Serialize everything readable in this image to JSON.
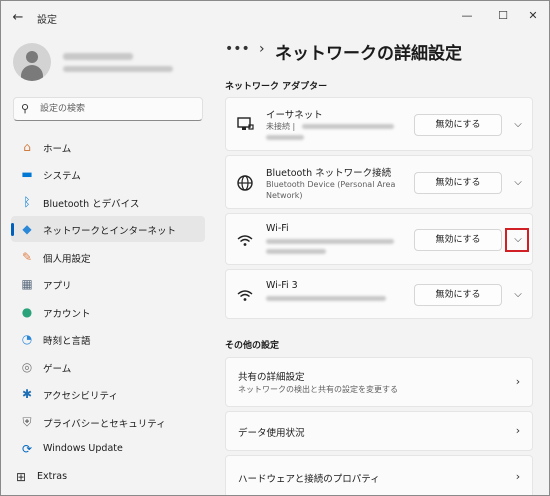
{
  "window": {
    "title": "設定",
    "back_icon": "back-arrow-icon",
    "controls": {
      "minimize": "—",
      "maximize": "☐",
      "close": "✕"
    }
  },
  "sidebar": {
    "search_placeholder": "設定の検索",
    "items": [
      {
        "label": "ホーム",
        "icon": "home-icon",
        "glyph": "⌂",
        "color": "#d17b3f"
      },
      {
        "label": "システム",
        "icon": "system-icon",
        "glyph": "▬",
        "color": "#0078d4"
      },
      {
        "label": "Bluetooth とデバイス",
        "icon": "bluetooth-icon",
        "glyph": "ᛒ",
        "color": "#0078d4"
      },
      {
        "label": "ネットワークとインターネット",
        "icon": "network-icon",
        "glyph": "◆",
        "color": "#2b88d8",
        "selected": true
      },
      {
        "label": "個人用設定",
        "icon": "brush-icon",
        "glyph": "✎",
        "color": "#e0814a"
      },
      {
        "label": "アプリ",
        "icon": "apps-icon",
        "glyph": "▦",
        "color": "#5a6b7d"
      },
      {
        "label": "アカウント",
        "icon": "account-icon",
        "glyph": "●",
        "color": "#2aa37a"
      },
      {
        "label": "時刻と言語",
        "icon": "time-language-icon",
        "glyph": "◔",
        "color": "#2b88d8"
      },
      {
        "label": "ゲーム",
        "icon": "gaming-icon",
        "glyph": "◎",
        "color": "#777777"
      },
      {
        "label": "アクセシビリティ",
        "icon": "accessibility-icon",
        "glyph": "✱",
        "color": "#1f6fb5"
      },
      {
        "label": "プライバシーとセキュリティ",
        "icon": "shield-icon",
        "glyph": "⛨",
        "color": "#6b6b6b"
      },
      {
        "label": "Windows Update",
        "icon": "windows-update-icon",
        "glyph": "⟳",
        "color": "#0067c0"
      },
      {
        "label": "Extras",
        "icon": "extras-icon",
        "glyph": "⊞",
        "color": "#333333"
      }
    ]
  },
  "main": {
    "breadcrumb_dots": "•••",
    "breadcrumb_sep": "›",
    "title": "ネットワークの詳細設定",
    "adapters_heading": "ネットワーク アダプター",
    "adapters": [
      {
        "name": "イーサネット",
        "status": "未接続 |",
        "icon": "ethernet-icon",
        "button": "無効にする"
      },
      {
        "name": "Bluetooth ネットワーク接続",
        "status": "Bluetooth Device (Personal Area Network)",
        "icon": "globe-icon",
        "button": "無効にする"
      },
      {
        "name": "Wi-Fi",
        "status": "",
        "icon": "wifi-icon",
        "button": "無効にする",
        "highlight": true
      },
      {
        "name": "Wi-Fi 3",
        "status": "",
        "icon": "wifi-icon",
        "button": "無効にする"
      }
    ],
    "other_heading": "その他の設定",
    "other": [
      {
        "title": "共有の詳細設定",
        "sub": "ネットワークの検出と共有の設定を変更する"
      },
      {
        "title": "データ使用状況",
        "sub": ""
      },
      {
        "title": "ハードウェアと接続のプロパティ",
        "sub": ""
      }
    ],
    "highlight_color": "#d11f26"
  }
}
